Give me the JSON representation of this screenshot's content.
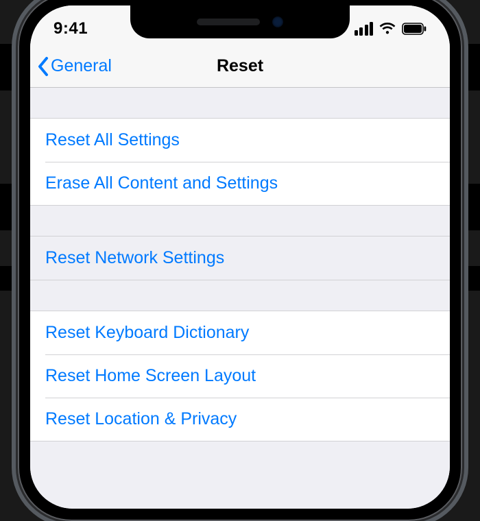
{
  "status": {
    "time": "9:41"
  },
  "nav": {
    "back_label": "General",
    "title": "Reset"
  },
  "groups": [
    {
      "rows": [
        {
          "key": "reset-all-settings",
          "label": "Reset All Settings"
        },
        {
          "key": "erase-all",
          "label": "Erase All Content and Settings"
        }
      ]
    },
    {
      "highlight": true,
      "rows": [
        {
          "key": "reset-network",
          "label": "Reset Network Settings"
        }
      ]
    },
    {
      "rows": [
        {
          "key": "reset-keyboard",
          "label": "Reset Keyboard Dictionary"
        },
        {
          "key": "reset-home-screen",
          "label": "Reset Home Screen Layout"
        },
        {
          "key": "reset-location-privacy",
          "label": "Reset Location & Privacy"
        }
      ]
    }
  ]
}
